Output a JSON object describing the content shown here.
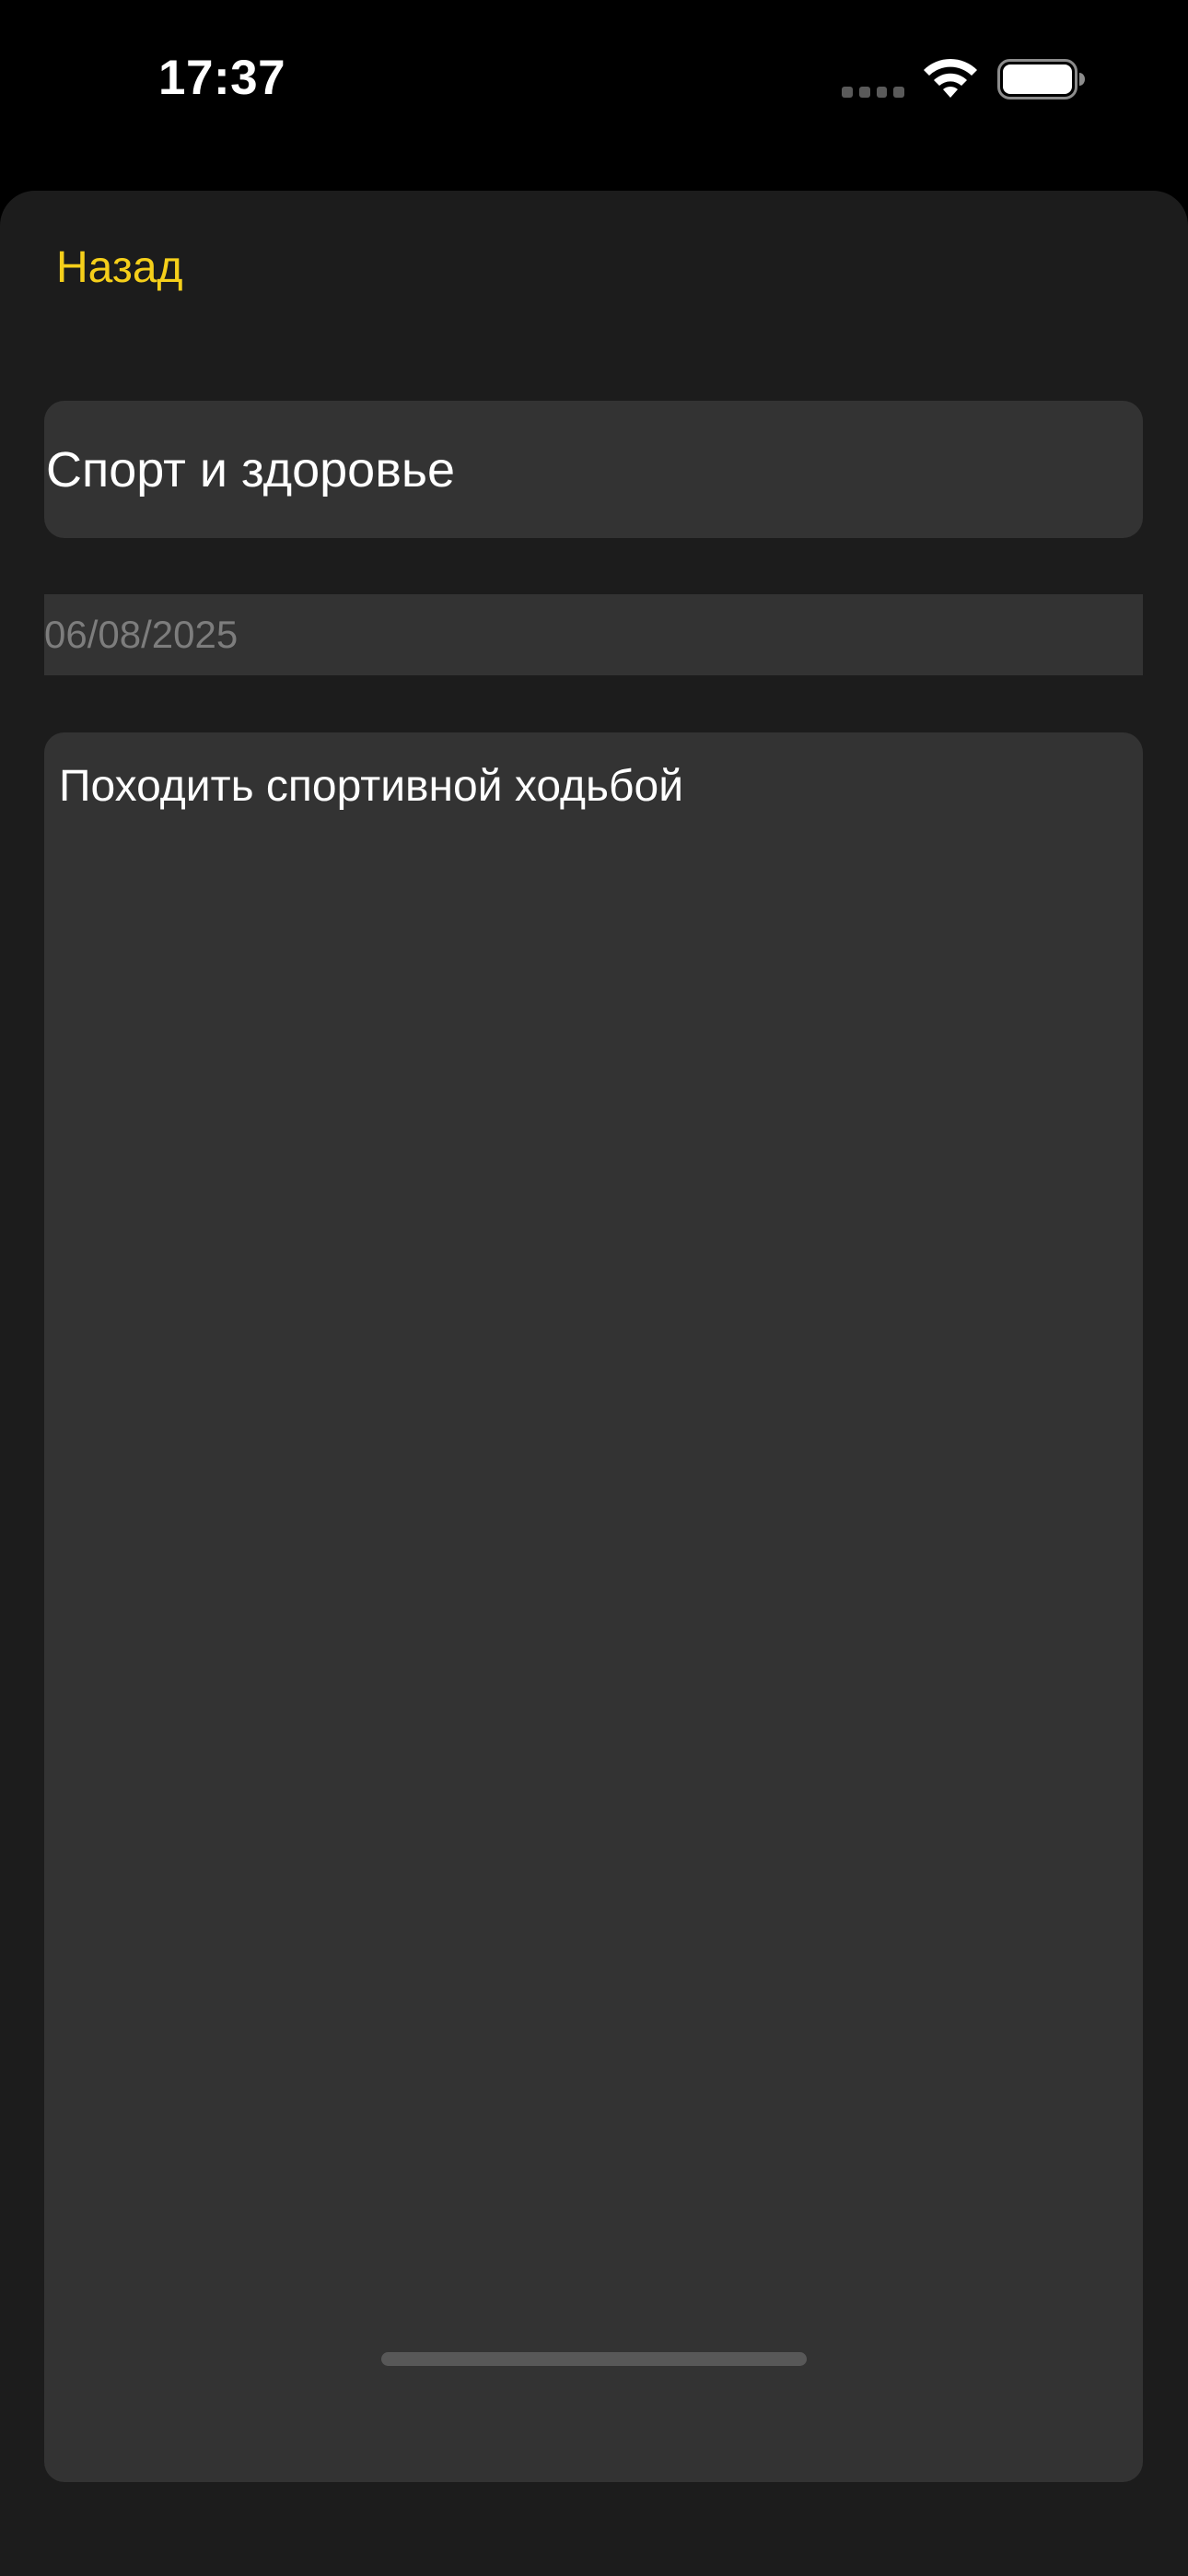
{
  "status_bar": {
    "time": "17:37",
    "icons": [
      "signal-icon",
      "wifi-icon",
      "battery-icon"
    ]
  },
  "nav": {
    "back_label": "Назад"
  },
  "form": {
    "title_value": "Спорт и здоровье",
    "date_value": "06/08/2025",
    "body_value": "Походить спортивной ходьбой"
  },
  "colors": {
    "accent": "#f5cf1a",
    "background": "#1c1c1c",
    "field": "#333333",
    "status_bar": "#000000",
    "muted_text": "#7d7d7d"
  }
}
